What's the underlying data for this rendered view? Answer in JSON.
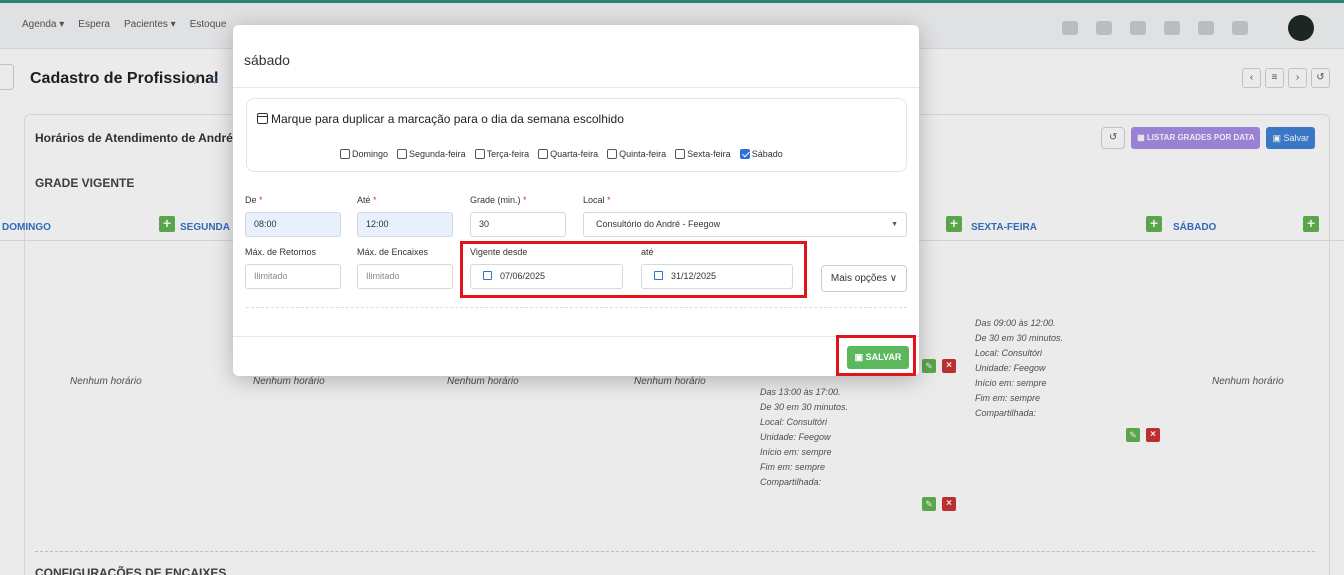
{
  "nav": {
    "items": [
      "Agenda ▾",
      "Espera",
      "Pacientes ▾",
      "Estoque"
    ]
  },
  "page": {
    "title": "Cadastro de Profissional",
    "pager": [
      "‹",
      "≡",
      "›",
      "↺"
    ]
  },
  "panel": {
    "title": "Horários de Atendimento de André M",
    "listar_label": "▦ LISTAR GRADES POR DATA",
    "salvar_label": "▣ Salvar",
    "grade_label": "GRADE VIGENTE",
    "encaixes_label": "CONFIGURAÇÕES DE ENCAIXES"
  },
  "days": {
    "domingo": "DOMINGO",
    "segunda": "SEGUNDA",
    "sexta": "SEXTA-FEIRA",
    "sabado": "SÁBADO"
  },
  "schedule": {
    "empty": "Nenhum horário",
    "slot_sexta": [
      "Das 09:00 às 12:00.",
      "De 30 em 30 minutos.",
      "Local: Consultóri",
      "Unidade: Feegow",
      "Início em: sempre",
      "Fim em: sempre",
      "Compartilhada:"
    ],
    "slot_quinta": [
      "Das 13:00 às 17:00.",
      "De 30 em 30 minutos.",
      "Local: Consultóri",
      "Unidade: Feegow",
      "Início em: sempre",
      "Fim em: sempre",
      "Compartilhada:"
    ]
  },
  "modal": {
    "title": "sábado",
    "duplicate_title": "Marque para duplicar a marcação para o dia da semana escolhido",
    "days": [
      {
        "label": "Domingo",
        "checked": false
      },
      {
        "label": "Segunda-feira",
        "checked": false
      },
      {
        "label": "Terça-feira",
        "checked": false
      },
      {
        "label": "Quarta-feira",
        "checked": false
      },
      {
        "label": "Quinta-feira",
        "checked": false
      },
      {
        "label": "Sexta-feira",
        "checked": false
      },
      {
        "label": "Sábado",
        "checked": true
      }
    ],
    "fields": {
      "de_label": "De",
      "de_value": "08:00",
      "ate_label": "Até",
      "ate_value": "12:00",
      "grade_label": "Grade (min.)",
      "grade_value": "30",
      "local_label": "Local",
      "local_value": "Consultório do André - Feegow",
      "max_retornos_label": "Máx. de Retornos",
      "max_retornos_placeholder": "Ilimitado",
      "max_encaixes_label": "Máx. de Encaixes",
      "max_encaixes_placeholder": "Ilimitado",
      "vigente_desde_label": "Vigente desde",
      "vigente_desde_value": "07/06/2025",
      "vigente_ate_label": "até",
      "vigente_ate_value": "31/12/2025"
    },
    "mais_opcoes": "Mais opções ∨",
    "save_label": "▣ SALVAR"
  }
}
